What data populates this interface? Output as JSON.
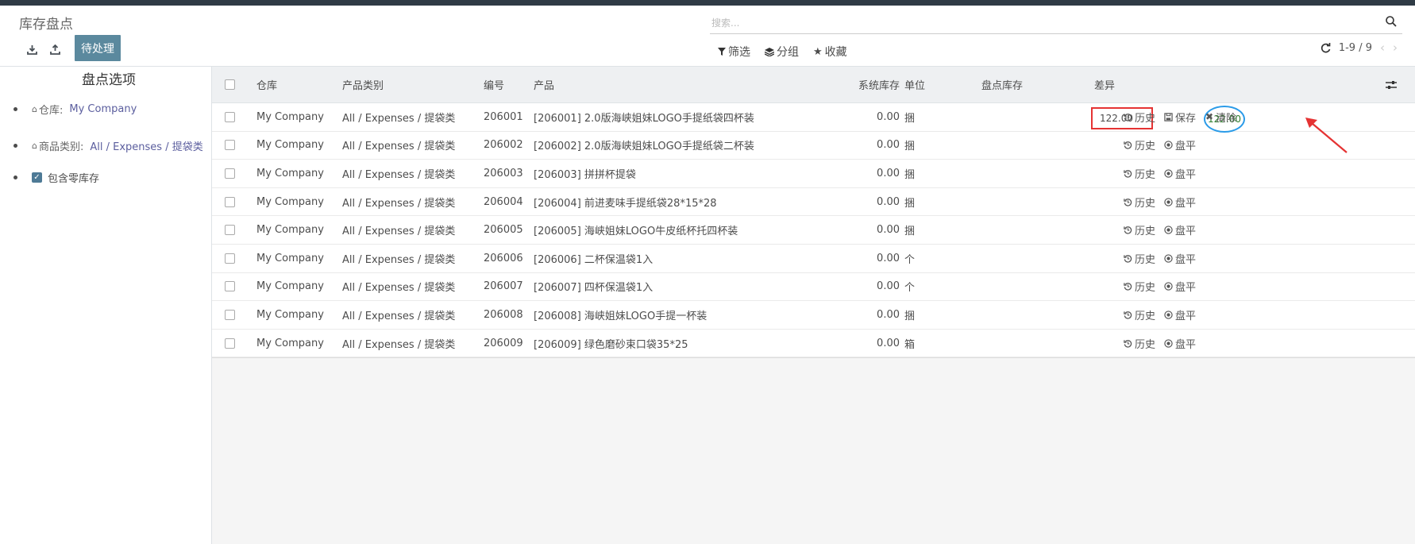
{
  "header": {
    "title": "库存盘点",
    "pending_label": "待处理",
    "search_placeholder": "搜索...",
    "filter_label": "筛选",
    "group_label": "分组",
    "favorite_label": "收藏",
    "pager_text": "1-9 / 9"
  },
  "sidebar": {
    "title": "盘点选项",
    "warehouse_label": "仓库:",
    "warehouse_value": "My Company",
    "category_label": "商品类别:",
    "category_value": "All / Expenses / 提袋类",
    "zero_stock_label": "包含零库存"
  },
  "table": {
    "columns": {
      "warehouse": "仓库",
      "category": "产品类别",
      "code": "编号",
      "product": "产品",
      "system_stock": "系统库存",
      "unit": "单位",
      "count_stock": "盘点库存",
      "difference": "差异"
    },
    "actions": {
      "history": "历史",
      "save": "保存",
      "clear": "清除",
      "balance": "盘平"
    },
    "rows": [
      {
        "warehouse": "My Company",
        "category": "All / Expenses / 提袋类",
        "code": "206001",
        "product": "[206001] 2.0版海峡姐妹LOGO手提纸袋四杯装",
        "system_stock": "0.00",
        "unit": "捆",
        "count": "122.00",
        "difference": "122.00",
        "editing": true
      },
      {
        "warehouse": "My Company",
        "category": "All / Expenses / 提袋类",
        "code": "206002",
        "product": "[206002] 2.0版海峡姐妹LOGO手提纸袋二杯装",
        "system_stock": "0.00",
        "unit": "捆"
      },
      {
        "warehouse": "My Company",
        "category": "All / Expenses / 提袋类",
        "code": "206003",
        "product": "[206003] 拼拼杯提袋",
        "system_stock": "0.00",
        "unit": "捆"
      },
      {
        "warehouse": "My Company",
        "category": "All / Expenses / 提袋类",
        "code": "206004",
        "product": "[206004] 前进麦味手提纸袋28*15*28",
        "system_stock": "0.00",
        "unit": "捆"
      },
      {
        "warehouse": "My Company",
        "category": "All / Expenses / 提袋类",
        "code": "206005",
        "product": "[206005] 海峡姐妹LOGO牛皮纸杯托四杯装",
        "system_stock": "0.00",
        "unit": "捆"
      },
      {
        "warehouse": "My Company",
        "category": "All / Expenses / 提袋类",
        "code": "206006",
        "product": "[206006] 二杯保温袋1入",
        "system_stock": "0.00",
        "unit": "个"
      },
      {
        "warehouse": "My Company",
        "category": "All / Expenses / 提袋类",
        "code": "206007",
        "product": "[206007] 四杯保温袋1入",
        "system_stock": "0.00",
        "unit": "个"
      },
      {
        "warehouse": "My Company",
        "category": "All / Expenses / 提袋类",
        "code": "206008",
        "product": "[206008] 海峡姐妹LOGO手提一杯装",
        "system_stock": "0.00",
        "unit": "捆"
      },
      {
        "warehouse": "My Company",
        "category": "All / Expenses / 提袋类",
        "code": "206009",
        "product": "[206009] 绿色磨砂束口袋35*25",
        "system_stock": "0.00",
        "unit": "箱"
      }
    ]
  },
  "colors": {
    "accent": "#5b899e",
    "highlight_red": "#e53333",
    "highlight_blue": "#2a9be8",
    "difference_green": "#2e7d2e"
  }
}
